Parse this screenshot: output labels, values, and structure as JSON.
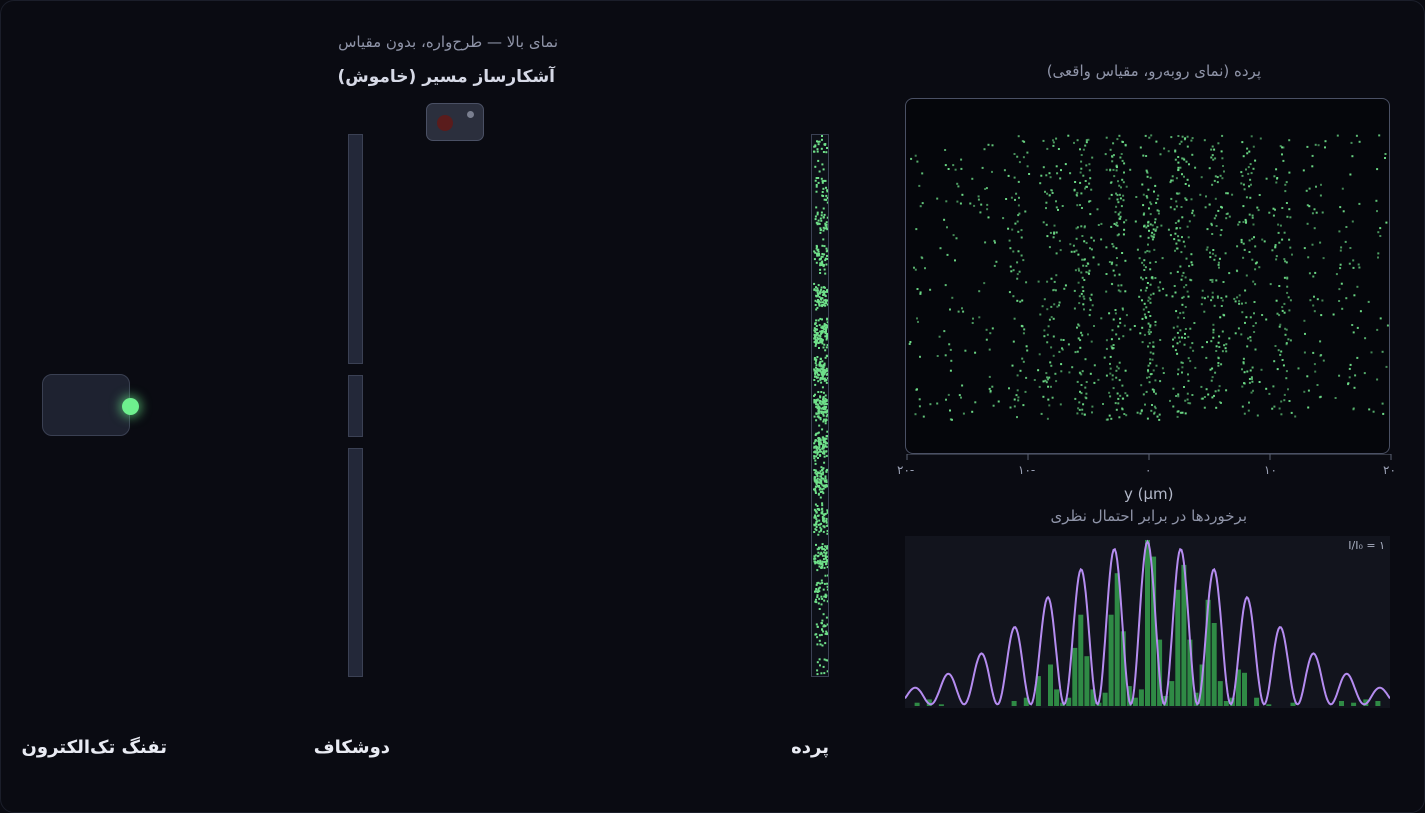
{
  "top_view": {
    "caption": "نمای بالا — طرح‌واره، بدون مقیاس",
    "path_detector_label": "آشکارساز مسیر (خاموش)"
  },
  "labels": {
    "gun": "تفنگ تک‌الکترون",
    "double_slit": "دوشکاف",
    "screen": "پرده"
  },
  "front_view": {
    "caption": "پرده (نمای روبه‌رو، مقیاس واقعی)",
    "x_ticks": [
      "۲۰-",
      "۱۰-",
      "۰",
      "۱۰",
      "۲۰"
    ],
    "x_label": "y (μm)"
  },
  "histogram": {
    "caption": "برخوردها در برابر احتمال نظری",
    "ratio_label": "۱ = I/I₀"
  },
  "colors": {
    "hit": "#6fe08a",
    "curve": "#b58cf0",
    "bar": "#2f8a45",
    "accent_glow": "#6ef08e"
  },
  "chart_data": {
    "type": "bar",
    "title": "برخوردها در برابر احتمال نظری",
    "xlabel": "y (μm)",
    "xlim": [
      -20,
      20
    ],
    "ylim": [
      0,
      1
    ],
    "x_ticks": [
      -20,
      -10,
      0,
      10,
      20
    ],
    "series": [
      {
        "kind": "bars",
        "x": [
          -19,
          -18,
          -17,
          -16,
          -15,
          -14,
          -13,
          -12,
          -11,
          -10,
          -9,
          -8,
          -7.5,
          -7,
          -6.5,
          -6,
          -5.5,
          -5,
          -4.5,
          -4,
          -3.5,
          -3,
          -2.5,
          -2,
          -1.5,
          -1,
          -0.5,
          0,
          0.5,
          1,
          1.5,
          2,
          2.5,
          3,
          3.5,
          4,
          4.5,
          5,
          5.5,
          6,
          6.5,
          7,
          7.5,
          8,
          9,
          10,
          11,
          12,
          13,
          14,
          15,
          16,
          17,
          18,
          19
        ],
        "values": [
          0.02,
          0.04,
          0.01,
          0.0,
          0.0,
          0.0,
          0.0,
          0.0,
          0.03,
          0.05,
          0.18,
          0.25,
          0.1,
          0.02,
          0.05,
          0.35,
          0.55,
          0.3,
          0.1,
          0.02,
          0.08,
          0.55,
          0.8,
          0.45,
          0.12,
          0.05,
          0.1,
          1.0,
          0.9,
          0.4,
          0.06,
          0.15,
          0.7,
          0.85,
          0.4,
          0.08,
          0.25,
          0.64,
          0.5,
          0.15,
          0.03,
          0.05,
          0.22,
          0.2,
          0.05,
          0.01,
          0.0,
          0.02,
          0.0,
          0.0,
          0.0,
          0.03,
          0.02,
          0.04,
          0.03
        ]
      },
      {
        "kind": "line",
        "description_key": "theoretical probability",
        "x_from": -20,
        "x_to": 20,
        "fringe_spacing": 2.75,
        "envelope_width": 9.0
      }
    ]
  }
}
